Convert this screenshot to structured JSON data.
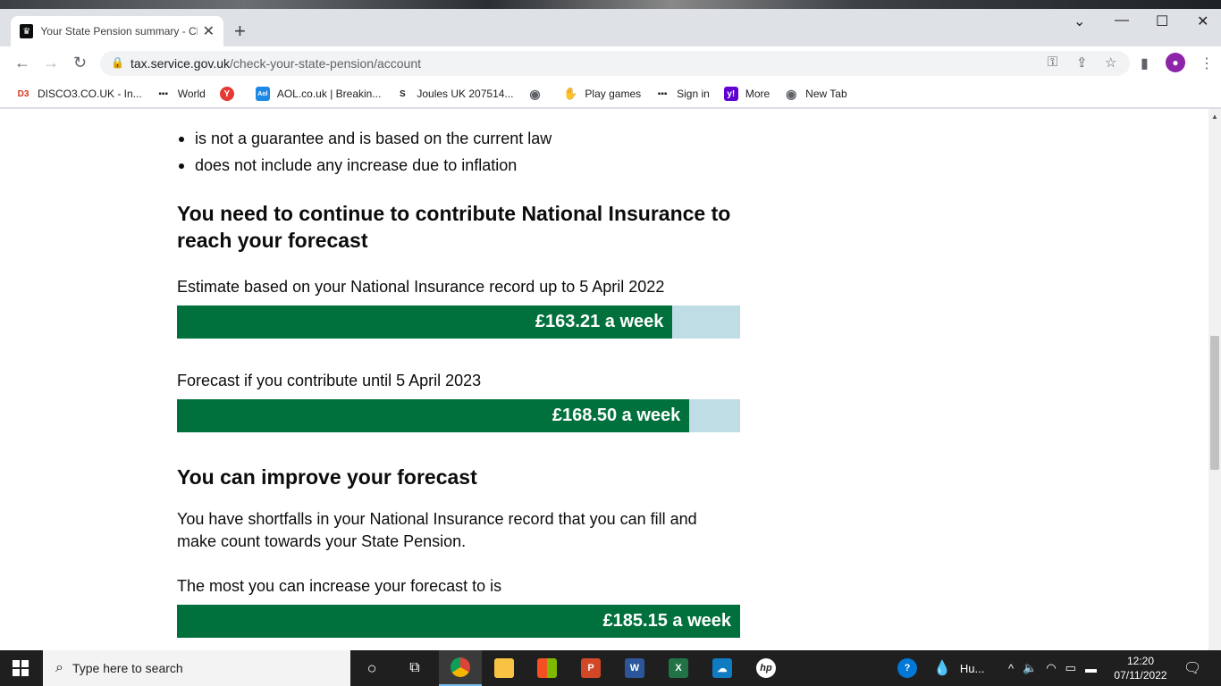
{
  "browser": {
    "tab_title": "Your State Pension summary - Ch",
    "tab_favicon": "crown-icon",
    "url_domain": "tax.service.gov.uk",
    "url_path": "/check-your-state-pension/account",
    "bookmarks": [
      {
        "label": "DISCO3.CO.UK - In...",
        "icon": "D3",
        "color": "#d4351c"
      },
      {
        "label": "World",
        "icon": "▪▪▪",
        "color": "#202124"
      },
      {
        "label": "",
        "icon": "Y",
        "color": "#e53935"
      },
      {
        "label": "AOL.co.uk | Breakin...",
        "icon": "Aol",
        "color": "#1e88e5"
      },
      {
        "label": "Joules UK 207514...",
        "icon": "S",
        "color": "#202124"
      },
      {
        "label": "",
        "icon": "◉",
        "color": "#5f6368"
      },
      {
        "label": "Play games",
        "icon": "✋",
        "color": "#5f6368"
      },
      {
        "label": "Sign in",
        "icon": "▪▪▪",
        "color": "#202124"
      },
      {
        "label": "More",
        "icon": "y!",
        "color": "#6001d2"
      },
      {
        "label": "New Tab",
        "icon": "◉",
        "color": "#5f6368"
      }
    ]
  },
  "page": {
    "bullets": [
      "is not a guarantee and is based on the current law",
      "does not include any increase due to inflation"
    ],
    "heading_contribute": "You need to continue to contribute National Insurance to reach your forecast",
    "estimate_label": "Estimate based on your National Insurance record up to 5 April 2022",
    "estimate_value": "£163.21 a week",
    "estimate_fraction": 0.88,
    "forecast_label": "Forecast if you contribute until 5 April 2023",
    "forecast_value": "£168.50 a week",
    "forecast_fraction": 0.91,
    "heading_improve": "You can improve your forecast",
    "shortfall_text": "You have shortfalls in your National Insurance record that you can fill and make count towards your State Pension.",
    "max_label": "The most you can increase your forecast to is",
    "max_value": "£185.15 a week",
    "max_fraction": 1.0,
    "colors": {
      "bar_fill": "#00703c",
      "bar_track": "#bfdde4",
      "text": "#0b0c0c"
    }
  },
  "taskbar": {
    "search_placeholder": "Type here to search",
    "tray_label": "Hu...",
    "time": "12:20",
    "date": "07/11/2022"
  }
}
